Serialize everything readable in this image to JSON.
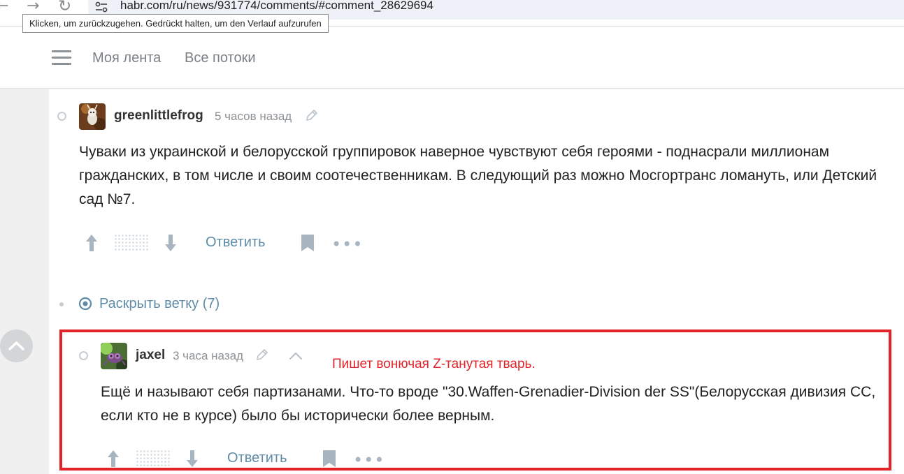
{
  "browser": {
    "back_glyph": "←",
    "forward_glyph": "→",
    "reload_glyph": "↻",
    "url": "habr.com/ru/news/931774/comments/#comment_28629694",
    "tooltip": "Klicken, um zurückzugehen. Gedrückt halten, um den Verlauf aufzurufen"
  },
  "header": {
    "nav": [
      "Моя лента",
      "Все потоки"
    ]
  },
  "comments": [
    {
      "username": "greenlittlefrog",
      "time": "5 часов назад",
      "text": "Чуваки из украинской и белорусской группировок наверное чувствуют себя героями - поднасрали миллионам гражданских, в том числе и своим соотечественникам. В следующий раз можно Мосгортранс ломануть, или Детский сад №7.",
      "actions": {
        "reply": "Ответить",
        "more": "•••"
      }
    },
    {
      "username": "jaxel",
      "time": "3 часа назад",
      "text": "Ещё и называют себя партизанами. Что-то вроде \"30.Waffen-Grenadier-Division der SS\"(Белорусская дивизия СС, если кто не в курсе) было бы исторически более верным.",
      "actions": {
        "reply": "Ответить",
        "more": "•••"
      }
    }
  ],
  "thread": {
    "expand_label": "Раскрыть ветку (7)"
  },
  "annotation": {
    "text": "Пишет вонючая Z-танутая тварь.",
    "color": "#e2232a"
  },
  "colors": {
    "link": "#5e8ca8",
    "vote_icon": "#a8b5c0",
    "annotation_red": "#e2232a"
  },
  "icons": [
    "back-arrow-icon",
    "forward-arrow-icon",
    "reload-icon",
    "site-settings-icon",
    "menu-icon",
    "pencil-icon",
    "upvote-arrow-icon",
    "downvote-arrow-icon",
    "bookmark-icon",
    "more-dots-icon",
    "expand-thread-icon",
    "chevron-up-icon",
    "scroll-to-top-icon"
  ]
}
